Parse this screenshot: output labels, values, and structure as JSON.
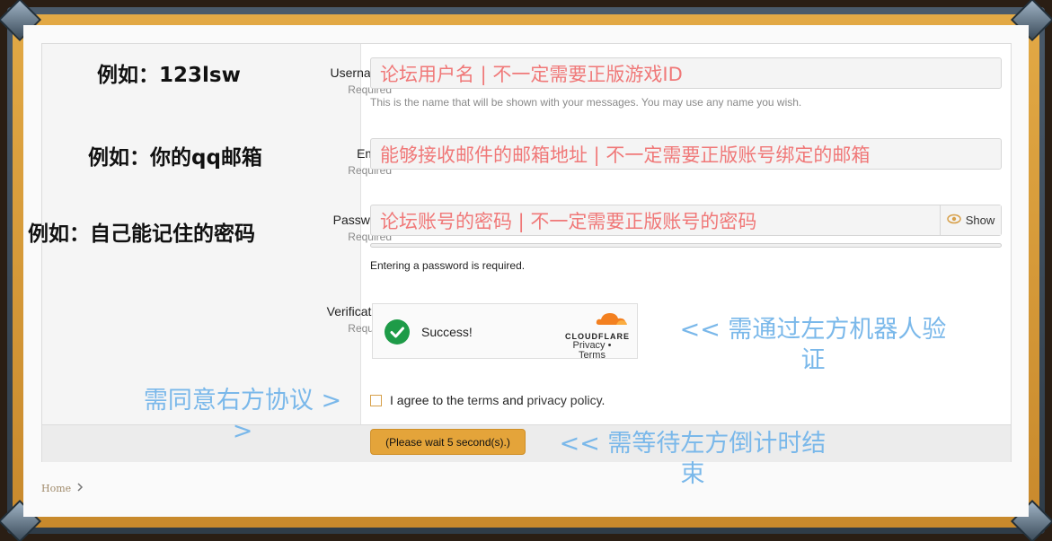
{
  "colors": {
    "input_text": "#f07878",
    "annotation_blue": "#7ab8ea",
    "button": "#e4a43a",
    "success_green": "#1e9b48",
    "frame_gold": "#d89a36"
  },
  "form": {
    "username": {
      "label": "Username:",
      "required": "Required",
      "value": "论坛用户名 | 不一定需要正版游戏ID",
      "hint": "This is the name that will be shown with your messages. You may use any name you wish."
    },
    "email": {
      "label": "Email:",
      "required": "Required",
      "value": "能够接收邮件的邮箱地址 | 不一定需要正版账号绑定的邮箱"
    },
    "password": {
      "label": "Password:",
      "required": "Required",
      "value": "论坛账号的密码 | 不一定需要正版账号的密码",
      "show_label": "Show",
      "show_icon": "eye-icon",
      "hint": "Entering a password is required."
    },
    "verification": {
      "label": "Verification:",
      "required": "Required",
      "status": "Success!",
      "brand": "CLOUDFLARE",
      "privacy": "Privacy",
      "separator": "•",
      "terms": "Terms"
    },
    "agree": {
      "prefix": "I agree to the",
      "terms_link": "terms",
      "and": "and",
      "privacy_link": "privacy policy",
      "suffix": "."
    },
    "submit_label": "(Please wait 5 second(s).)"
  },
  "annotations": {
    "username_example": "例如：123lsw",
    "email_example": "例如：你的qq邮箱",
    "password_example": "例如：自己能记住的密码",
    "verification_note_line1": "<< 需通过左方机器人验",
    "verification_note_line2": "证",
    "agree_note_line1": "需同意右方协议 >",
    "agree_note_line2": ">",
    "wait_note_line1": "<< 需等待左方倒计时结",
    "wait_note_line2": "束"
  },
  "breadcrumb": {
    "home": "Home",
    "separator_icon": "chevron-right-icon"
  }
}
